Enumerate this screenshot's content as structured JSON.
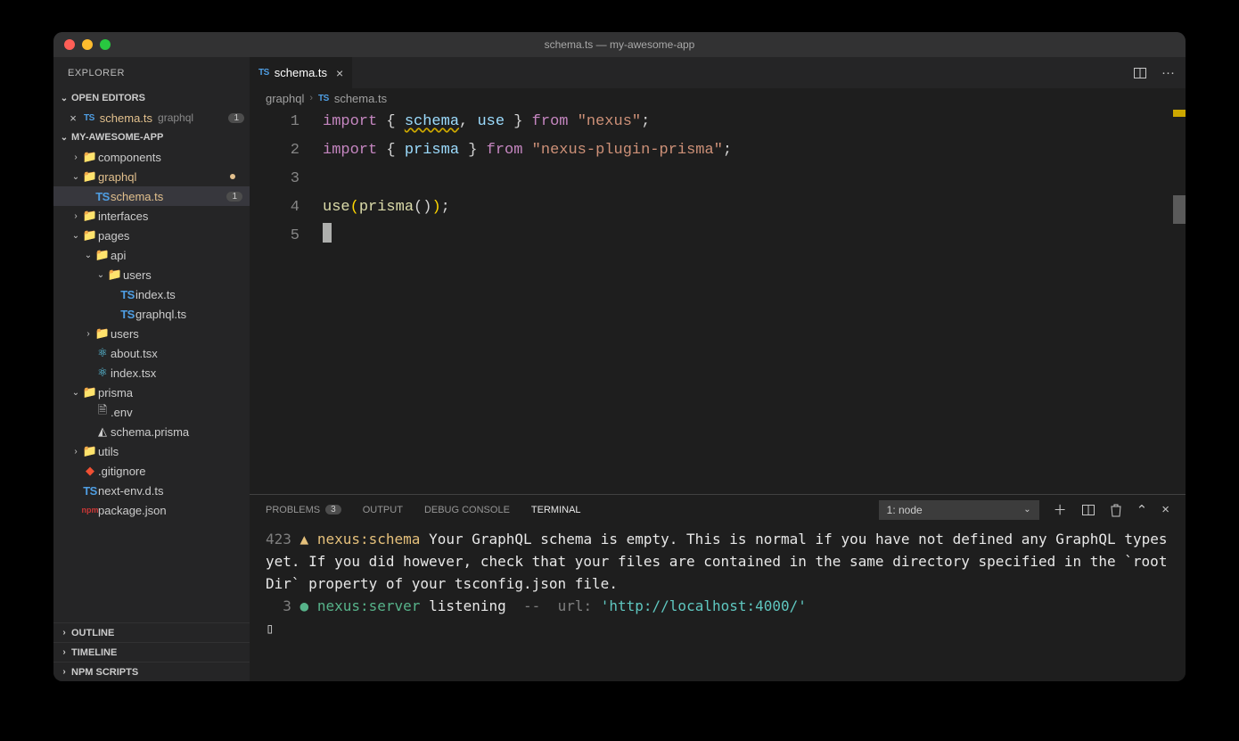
{
  "window": {
    "title": "schema.ts — my-awesome-app"
  },
  "sidebar": {
    "title": "EXPLORER",
    "openEditors": {
      "label": "OPEN EDITORS",
      "items": [
        {
          "name": "schema.ts",
          "path": "graphql",
          "badge": "1"
        }
      ]
    },
    "project": {
      "label": "MY-AWESOME-APP"
    },
    "outline": {
      "label": "OUTLINE"
    },
    "timeline": {
      "label": "TIMELINE"
    },
    "npm": {
      "label": "NPM SCRIPTS"
    }
  },
  "tree": [
    {
      "depth": 1,
      "kind": "folder",
      "open": false,
      "label": "components"
    },
    {
      "depth": 1,
      "kind": "folder",
      "open": true,
      "label": "graphql",
      "modified": true,
      "dot": true
    },
    {
      "depth": 2,
      "kind": "file-ts",
      "label": "schema.ts",
      "modified": true,
      "active": true,
      "badge": "1"
    },
    {
      "depth": 1,
      "kind": "folder",
      "open": false,
      "label": "interfaces"
    },
    {
      "depth": 1,
      "kind": "folder",
      "open": true,
      "label": "pages"
    },
    {
      "depth": 2,
      "kind": "folder",
      "open": true,
      "label": "api"
    },
    {
      "depth": 3,
      "kind": "folder",
      "open": true,
      "label": "users"
    },
    {
      "depth": 4,
      "kind": "file-ts",
      "label": "index.ts"
    },
    {
      "depth": 4,
      "kind": "file-ts",
      "label": "graphql.ts"
    },
    {
      "depth": 2,
      "kind": "folder",
      "open": false,
      "label": "users"
    },
    {
      "depth": 2,
      "kind": "file-react",
      "label": "about.tsx"
    },
    {
      "depth": 2,
      "kind": "file-react",
      "label": "index.tsx"
    },
    {
      "depth": 1,
      "kind": "folder",
      "open": true,
      "label": "prisma"
    },
    {
      "depth": 2,
      "kind": "file",
      "label": ".env"
    },
    {
      "depth": 2,
      "kind": "file-prisma",
      "label": "schema.prisma"
    },
    {
      "depth": 1,
      "kind": "folder",
      "open": false,
      "label": "utils"
    },
    {
      "depth": 1,
      "kind": "file-git",
      "label": ".gitignore"
    },
    {
      "depth": 1,
      "kind": "file-ts",
      "label": "next-env.d.ts"
    },
    {
      "depth": 1,
      "kind": "file-npm",
      "label": "package.json"
    }
  ],
  "tabs": [
    {
      "label": "schema.ts",
      "icon": "ts"
    }
  ],
  "breadcrumb": {
    "folder": "graphql",
    "file": "schema.ts"
  },
  "editor": {
    "lines": [
      {
        "n": "1",
        "tokens": [
          {
            "t": "import",
            "c": "tok-kw"
          },
          {
            "t": " { ",
            "c": "tok-pn"
          },
          {
            "t": "schema",
            "c": "tok-id underline-warn"
          },
          {
            "t": ", ",
            "c": "tok-pn"
          },
          {
            "t": "use",
            "c": "tok-id"
          },
          {
            "t": " } ",
            "c": "tok-pn"
          },
          {
            "t": "from",
            "c": "tok-kw"
          },
          {
            "t": " ",
            "c": ""
          },
          {
            "t": "\"nexus\"",
            "c": "tok-str"
          },
          {
            "t": ";",
            "c": "tok-pn"
          }
        ]
      },
      {
        "n": "2",
        "tokens": [
          {
            "t": "import",
            "c": "tok-kw"
          },
          {
            "t": " { ",
            "c": "tok-pn"
          },
          {
            "t": "prisma",
            "c": "tok-id"
          },
          {
            "t": " } ",
            "c": "tok-pn"
          },
          {
            "t": "from",
            "c": "tok-kw"
          },
          {
            "t": " ",
            "c": ""
          },
          {
            "t": "\"nexus-plugin-prisma\"",
            "c": "tok-str"
          },
          {
            "t": ";",
            "c": "tok-pn"
          }
        ]
      },
      {
        "n": "3",
        "tokens": []
      },
      {
        "n": "4",
        "tokens": [
          {
            "t": "use",
            "c": "tok-fn"
          },
          {
            "t": "(",
            "c": "tok-br"
          },
          {
            "t": "prisma",
            "c": "tok-fn"
          },
          {
            "t": "()",
            "c": "tok-pn"
          },
          {
            "t": ")",
            "c": "tok-br"
          },
          {
            "t": ";",
            "c": "tok-pn"
          }
        ]
      },
      {
        "n": "5",
        "tokens": [],
        "cursor": true
      }
    ]
  },
  "panel": {
    "tabs": {
      "problems": "PROBLEMS",
      "problemsCount": "3",
      "output": "OUTPUT",
      "debug": "DEBUG CONSOLE",
      "terminal": "TERMINAL"
    },
    "terminalSelect": "1: node",
    "terminal": {
      "line1_count": "423",
      "line1_tri": "▲",
      "line1_tag": "nexus:schema",
      "line1_msg": "Your GraphQL schema is empty. This is normal if you have not defined any GraphQL types yet. If you did however, check that your files are contained in the same directory specified in the `rootDir` property of your tsconfig.json file.",
      "line2_count": "3",
      "line2_dot": "●",
      "line2_tag": "nexus:server",
      "line2_msg": "listening",
      "line2_sep": "--",
      "line2_key": "url:",
      "line2_url": "'http://localhost:4000/'",
      "cursor": "▯"
    }
  }
}
